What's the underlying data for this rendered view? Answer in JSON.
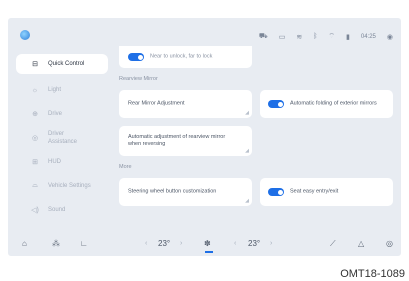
{
  "status": {
    "time": "04:25",
    "icons": [
      "car-icon",
      "screen-icon",
      "wireless-icon",
      "bluetooth-icon",
      "wifi-icon",
      "signal-icon",
      "profile-icon"
    ]
  },
  "sidebar": {
    "items": [
      {
        "label": "Quick Control",
        "icon": "car-front-icon",
        "active": true
      },
      {
        "label": "Light",
        "icon": "light-icon",
        "active": false
      },
      {
        "label": "Drive",
        "icon": "steering-icon",
        "active": false
      },
      {
        "label": "Driver Assistance",
        "icon": "assist-icon",
        "active": false
      },
      {
        "label": "HUD",
        "icon": "hud-icon",
        "active": false
      },
      {
        "label": "Vehicle Settings",
        "icon": "vehicle-icon",
        "active": false
      },
      {
        "label": "Sound",
        "icon": "sound-icon",
        "active": false
      }
    ]
  },
  "main": {
    "top_card": {
      "label": "Near to unlock, far to lock",
      "toggle_on": true
    },
    "rearview_section": "Rearview Mirror",
    "rear_mirror_adjustment": "Rear Mirror Adjustment",
    "auto_folding": {
      "label": "Automatic folding of exterior mirrors",
      "toggle_on": true
    },
    "auto_adjust_reversing": "Automatic adjustment of rearview mirror when reversing",
    "more_section": "More",
    "steering_button": "Steering wheel button customization",
    "seat_easy": {
      "label": "Seat easy entry/exit",
      "toggle_on": true
    }
  },
  "bottom": {
    "left_temp": "23°",
    "right_temp": "23°",
    "chev_left": "‹",
    "chev_right": "›"
  },
  "caption": "OMT18-1089",
  "colors": {
    "accent": "#1e6fe6",
    "background": "#e8ecf2",
    "card": "#ffffff"
  }
}
